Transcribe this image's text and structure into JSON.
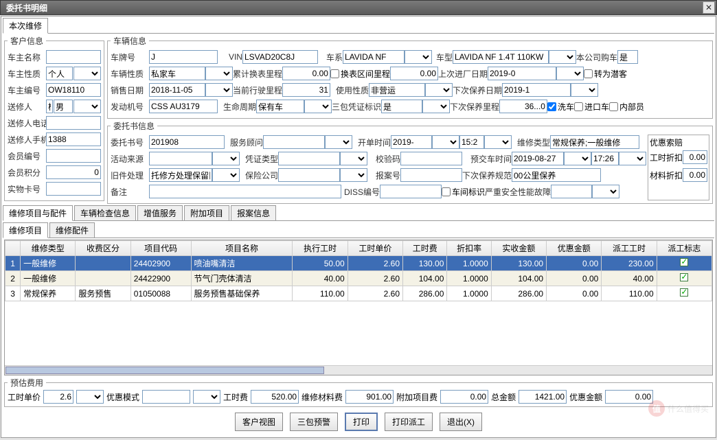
{
  "window": {
    "title": "委托书明细"
  },
  "outer_tab": {
    "tab1": "本次维修"
  },
  "customer": {
    "legend": "客户信息",
    "owner_name_lbl": "车主名称",
    "owner_name": "",
    "owner_type_lbl": "车主性质",
    "owner_type": "个人",
    "owner_no_lbl": "车主编号",
    "owner_no": "OW18110",
    "sender_lbl": "送修人",
    "sender": "杨",
    "sender_gender": "男",
    "sender_tel_lbl": "送修人电话",
    "sender_tel": "",
    "sender_mobile_lbl": "送修人手机",
    "sender_mobile": "1388",
    "member_no_lbl": "会员编号",
    "member_no": "",
    "member_pts_lbl": "会员积分",
    "member_pts": "0",
    "card_no_lbl": "实物卡号",
    "card_no": ""
  },
  "vehicle": {
    "legend": "车辆信息",
    "plate_lbl": "车牌号",
    "plate": "J",
    "vin_lbl": "VIN",
    "vin": "LSVAD20C8J",
    "series_lbl": "车系",
    "series": "LAVIDA NF",
    "model_lbl": "车型",
    "model": "LAVIDA NF 1.4T 110KW",
    "our_car_lbl": "本公司购车",
    "our_car": "是",
    "veh_type_lbl": "车辆性质",
    "veh_type": "私家车",
    "acc_mile_lbl": "累计换表里程",
    "acc_mile": "0.00",
    "chg_mile_lbl": "换表区间里程",
    "chg_mile": "0.00",
    "last_date_lbl": "上次进厂日期",
    "last_date": "2019-0",
    "to_guest_lbl": "转为潜客",
    "sale_date_lbl": "销售日期",
    "sale_date": "2018-11-05",
    "cur_mile_lbl": "当前行驶里程",
    "cur_mile": "31",
    "use_type_lbl": "使用性质",
    "use_type": "非营运",
    "next_maint_date_lbl": "下次保养日期",
    "next_maint_date": "2019-1",
    "engine_lbl": "发动机号",
    "engine": "CSS AU3179",
    "life_lbl": "生命周期",
    "life": "保有车",
    "sanbao_lbl": "三包凭证标识",
    "sanbao": "是",
    "next_maint_mile_lbl": "下次保养里程",
    "next_maint_mile": "36...0",
    "wash_lbl": "洗车",
    "import_lbl": "进口车",
    "internal_lbl": "内部员"
  },
  "order": {
    "legend": "委托书信息",
    "order_no_lbl": "委托书号",
    "order_no": "201908",
    "advisor_lbl": "服务顾问",
    "advisor": "",
    "open_time_lbl": "开单时间",
    "open_time": "2019-",
    "open_time2": "15:2",
    "repair_type_lbl": "维修类型",
    "repair_type": "常规保养;一般维修",
    "act_src_lbl": "活动来源",
    "act_src": "",
    "cert_type_lbl": "凭证类型",
    "cert_type": "",
    "check_code_lbl": "校验码",
    "check_code": "",
    "deliver_lbl": "预交车时间",
    "deliver_date": "2019-08-27",
    "deliver_time": "17:26",
    "old_part_lbl": "旧件处理",
    "old_part": "托修方处理保留旧",
    "ins_co_lbl": "保险公司",
    "ins_co": "",
    "report_no_lbl": "报案号",
    "report_no": "",
    "next_spec_lbl": "下次保养规范",
    "next_spec": "00公里保养",
    "remark_lbl": "备注",
    "remark": "",
    "diss_lbl": "DISS编号",
    "diss": "",
    "inter_flag_lbl": "车间标识",
    "fault_lbl": "严重安全性能故障",
    "disc_legend": "优惠索赔",
    "labor_disc_lbl": "工时折扣",
    "labor_disc": "0.00",
    "mat_disc_lbl": "材料折扣",
    "mat_disc": "0.00"
  },
  "grid": {
    "tabs": [
      "维修项目与配件",
      "车辆检查信息",
      "增值服务",
      "附加项目",
      "报案信息"
    ],
    "subtabs": [
      "维修项目",
      "维修配件"
    ],
    "cols": [
      "",
      "维修类型",
      "收费区分",
      "项目代码",
      "项目名称",
      "执行工时",
      "工时单价",
      "工时费",
      "折扣率",
      "实收金额",
      "优惠金额",
      "派工工时",
      "派工标志"
    ],
    "rows": [
      {
        "n": "1",
        "type": "一般维修",
        "charge": "",
        "code": "24402900",
        "name": "喷油嘴清洁",
        "hrs": "50.00",
        "price": "2.60",
        "fee": "130.00",
        "rate": "1.0000",
        "recv": "130.00",
        "disc": "0.00",
        "work": "230.00",
        "flag": true,
        "sel": true
      },
      {
        "n": "2",
        "type": "一般维修",
        "charge": "",
        "code": "24422900",
        "name": "节气门壳体清洁",
        "hrs": "40.00",
        "price": "2.60",
        "fee": "104.00",
        "rate": "1.0000",
        "recv": "104.00",
        "disc": "0.00",
        "work": "40.00",
        "flag": true,
        "alt": true
      },
      {
        "n": "3",
        "type": "常规保养",
        "charge": "服务预售",
        "code": "01050088",
        "name": "服务预售基础保养",
        "hrs": "110.00",
        "price": "2.60",
        "fee": "286.00",
        "rate": "1.0000",
        "recv": "286.00",
        "disc": "0.00",
        "work": "110.00",
        "flag": true
      }
    ]
  },
  "estimate": {
    "legend": "预估费用",
    "unit_lbl": "工时单价",
    "unit": "2.6",
    "mode_lbl": "优惠模式",
    "mode": "",
    "labor_lbl": "工时费",
    "labor": "520.00",
    "mat_lbl": "维修材料费",
    "mat": "901.00",
    "extra_lbl": "附加项目费",
    "extra": "0.00",
    "total_lbl": "总金额",
    "total": "1421.00",
    "disc_lbl": "优惠金额",
    "disc": "0.00"
  },
  "buttons": {
    "cust_view": "客户视图",
    "sanbao_warn": "三包预警",
    "print": "打印",
    "print_dispatch": "打印派工",
    "exit": "退出(X)"
  },
  "watermark": "什么值得买"
}
